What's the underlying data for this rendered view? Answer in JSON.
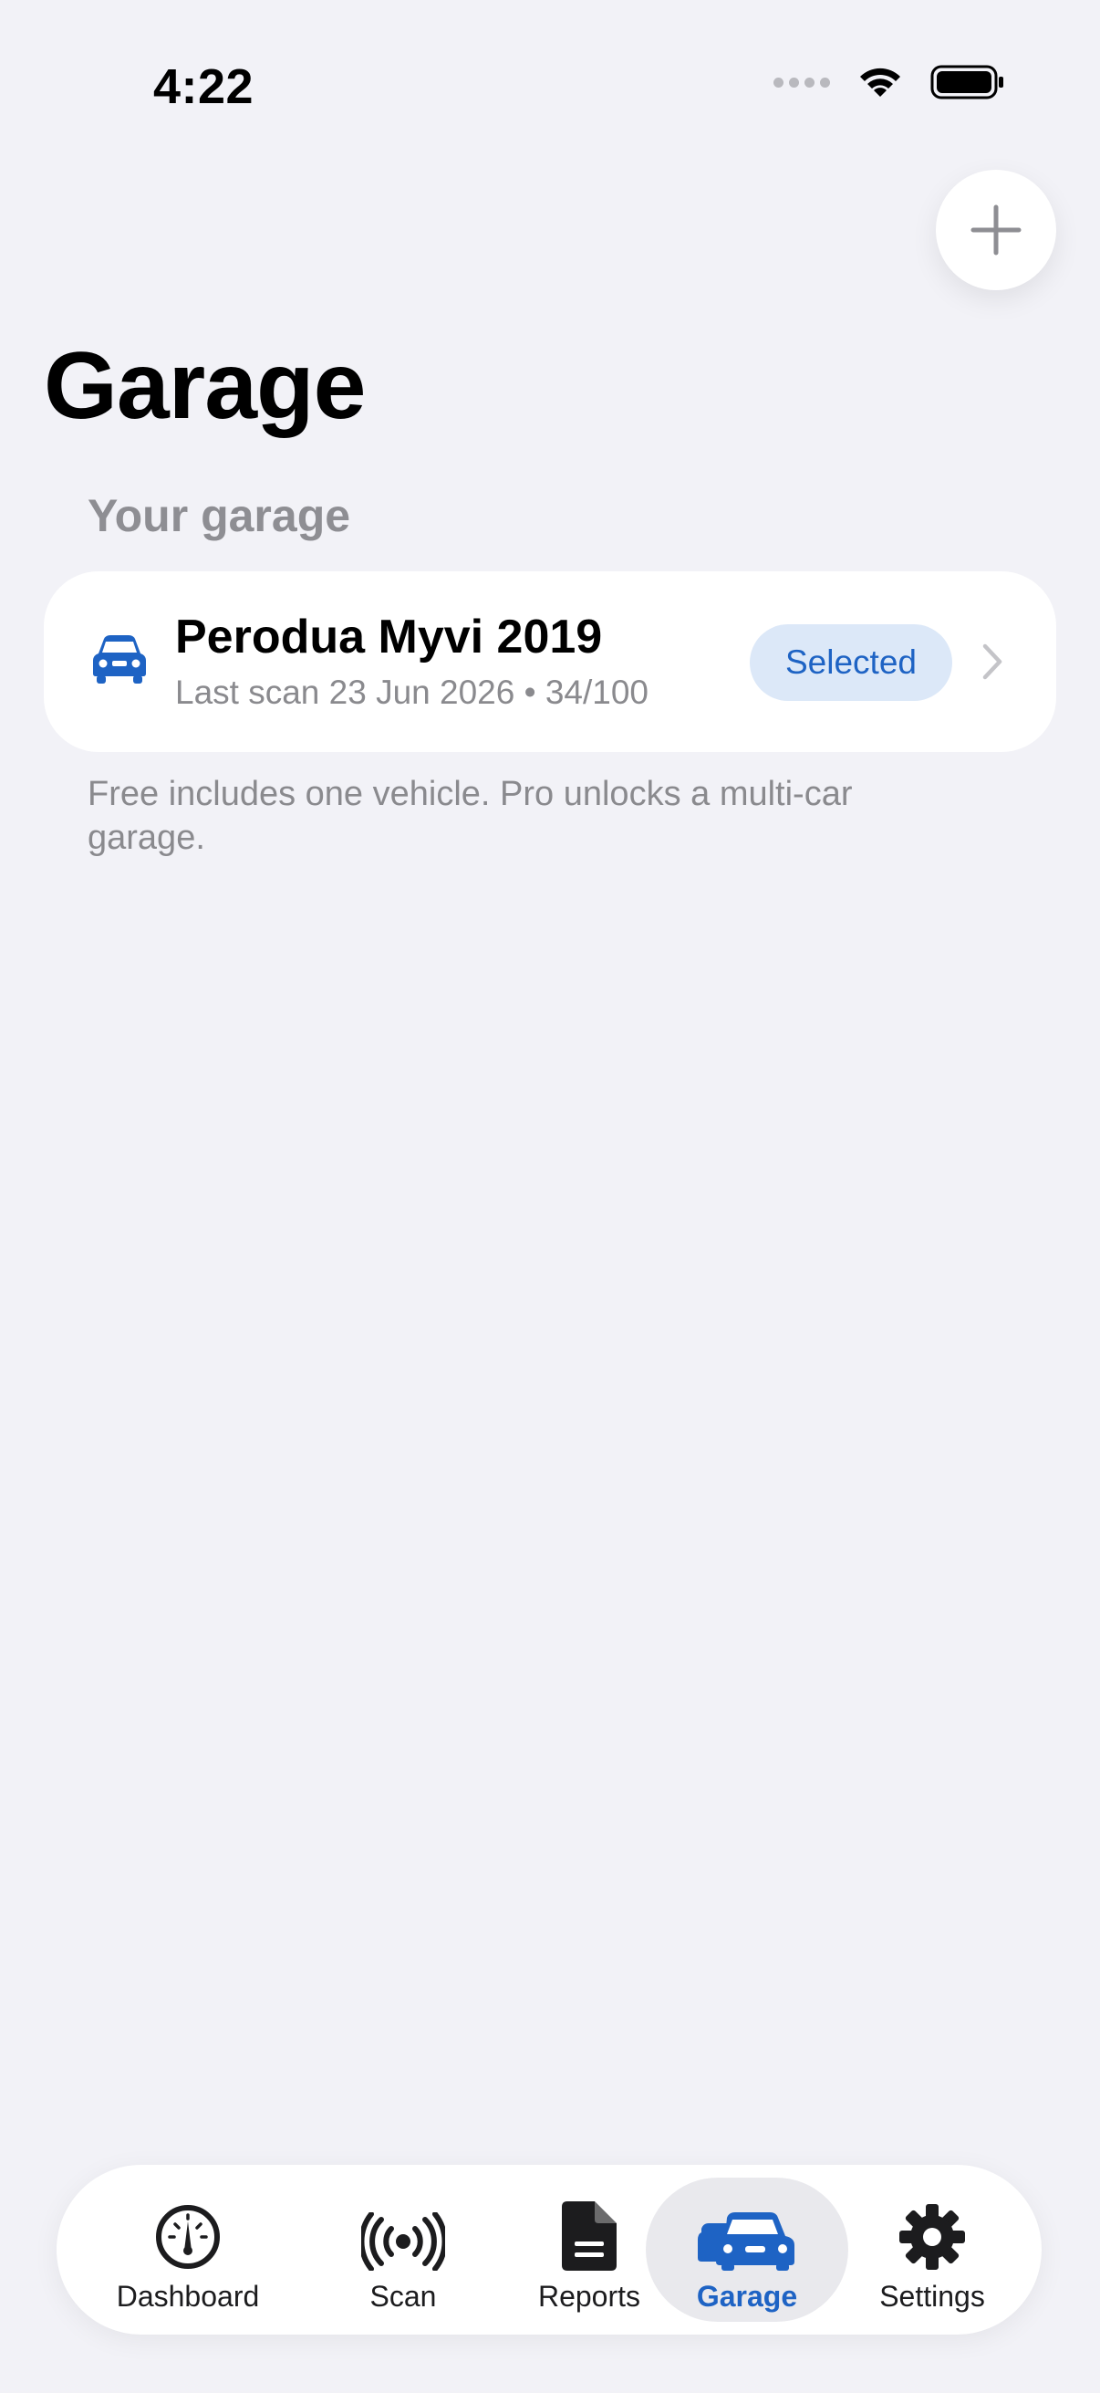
{
  "status_bar": {
    "time": "4:22"
  },
  "header": {
    "title": "Garage",
    "add_button_icon": "plus-icon"
  },
  "section": {
    "title": "Your garage"
  },
  "vehicles": [
    {
      "name": "Perodua Myvi 2019",
      "meta": "Last scan 23 Jun 2026 • 34/100",
      "badge": "Selected",
      "icon": "car-icon"
    }
  ],
  "footnote": "Free includes one vehicle. Pro unlocks a multi-car garage.",
  "tab_bar": {
    "active": "Garage",
    "tabs": [
      {
        "label": "Dashboard",
        "icon": "gauge-icon"
      },
      {
        "label": "Scan",
        "icon": "broadcast-icon"
      },
      {
        "label": "Reports",
        "icon": "document-icon"
      },
      {
        "label": "Garage",
        "icon": "cars-icon"
      },
      {
        "label": "Settings",
        "icon": "gear-icon"
      }
    ]
  },
  "colors": {
    "accent": "#1E63C4",
    "background": "#F2F2F7",
    "badge_bg": "#DCE8F8"
  }
}
